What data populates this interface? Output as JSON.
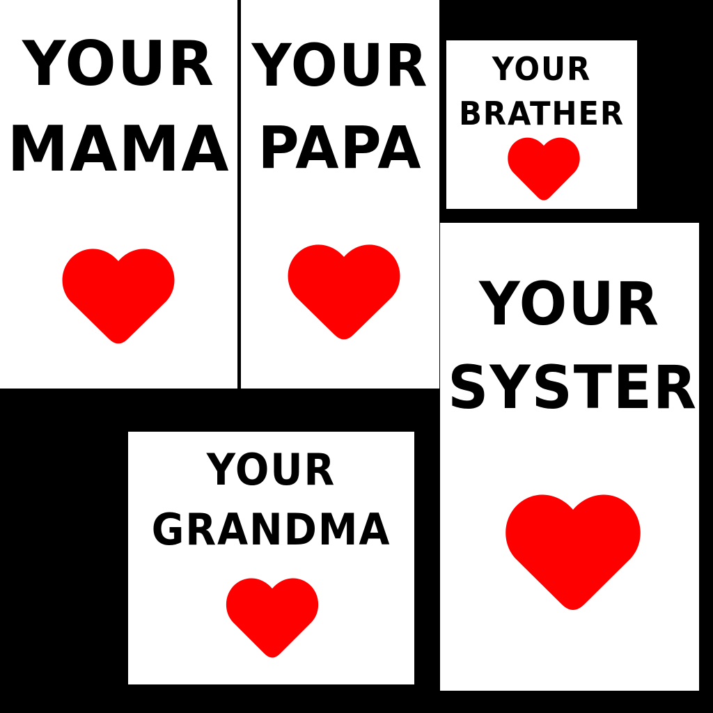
{
  "colors": {
    "background": "#000000",
    "card": "#ffffff",
    "text": "#000000",
    "heart": "#ff0000"
  },
  "cards": {
    "mama": {
      "line1": "YOUR",
      "line2": "MAMA",
      "icon": "heart-icon"
    },
    "papa": {
      "line1": "YOUR",
      "line2": "PAPA",
      "icon": "heart-icon"
    },
    "brather": {
      "line1": "YOUR",
      "line2": "BRATHER",
      "icon": "heart-icon"
    },
    "syster": {
      "line1": "YOUR",
      "line2": "SYSTER",
      "icon": "heart-icon"
    },
    "grandma": {
      "line1": "YOUR",
      "line2": "GRANDMA",
      "icon": "heart-icon"
    }
  }
}
